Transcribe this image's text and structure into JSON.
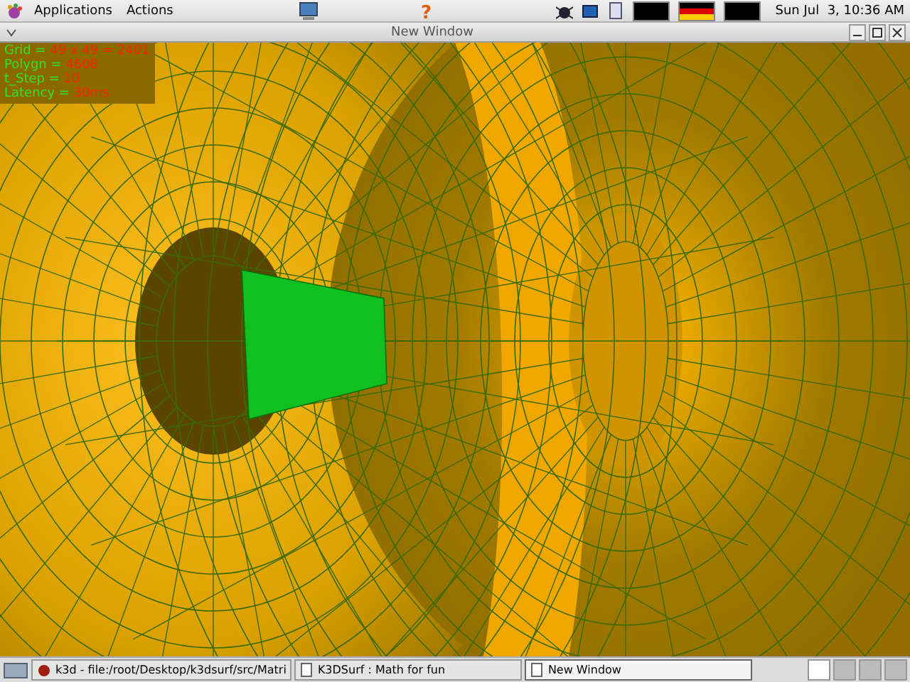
{
  "top_panel": {
    "menus": [
      "Applications",
      "Actions"
    ],
    "help_icon": "?",
    "clock": "Sun Jul  3, 10:36 AM"
  },
  "window": {
    "title": "New Window"
  },
  "overlay": [
    {
      "label": "Grid = ",
      "value": "49 x 49 = 2401"
    },
    {
      "label": "Polygn = ",
      "value": "4608"
    },
    {
      "label": "t_Step = ",
      "value": "10"
    },
    {
      "label": "Latency = ",
      "value": "30ms"
    }
  ],
  "taskbar": {
    "tasks": [
      {
        "label": "k3d - file:/root/Desktop/k3dsurf/src/Matri",
        "kind": "app",
        "selected": false
      },
      {
        "label": "K3DSurf : Math for fun",
        "kind": "doc",
        "selected": false
      },
      {
        "label": "New Window",
        "kind": "doc",
        "selected": true
      }
    ]
  }
}
